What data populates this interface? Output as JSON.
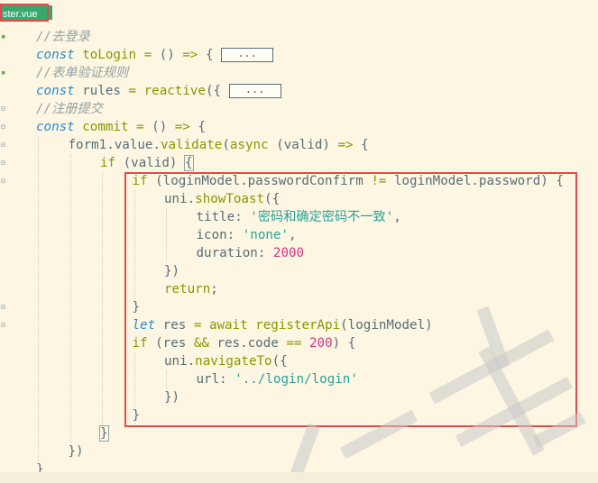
{
  "tab": {
    "label": "ster.vue"
  },
  "gutter_marks": [
    {
      "symbol": "▪",
      "kind": "g"
    },
    {
      "symbol": "",
      "kind": ""
    },
    {
      "symbol": "▪",
      "kind": "g"
    },
    {
      "symbol": "",
      "kind": ""
    },
    {
      "symbol": "⊟",
      "kind": ""
    },
    {
      "symbol": "⊟",
      "kind": ""
    },
    {
      "symbol": "⊟",
      "kind": ""
    },
    {
      "symbol": "⊟",
      "kind": ""
    },
    {
      "symbol": "⊟",
      "kind": ""
    },
    {
      "symbol": "",
      "kind": ""
    },
    {
      "symbol": "",
      "kind": ""
    },
    {
      "symbol": "",
      "kind": ""
    },
    {
      "symbol": "",
      "kind": ""
    },
    {
      "symbol": "",
      "kind": ""
    },
    {
      "symbol": "",
      "kind": ""
    },
    {
      "symbol": "⊟",
      "kind": ""
    },
    {
      "symbol": "⊟",
      "kind": ""
    },
    {
      "symbol": "",
      "kind": ""
    },
    {
      "symbol": "",
      "kind": ""
    },
    {
      "symbol": "",
      "kind": ""
    },
    {
      "symbol": "",
      "kind": ""
    },
    {
      "symbol": "",
      "kind": ""
    },
    {
      "symbol": "",
      "kind": ""
    },
    {
      "symbol": "",
      "kind": ""
    },
    {
      "symbol": "",
      "kind": ""
    }
  ],
  "code_lines": [
    {
      "indent": 0,
      "tokens": [
        [
          "cm",
          "//去登录"
        ]
      ]
    },
    {
      "indent": 0,
      "tokens": [
        [
          "kw",
          "const"
        ],
        [
          "id",
          " "
        ],
        [
          "fn",
          "toLogin"
        ],
        [
          "id",
          " "
        ],
        [
          "op",
          "="
        ],
        [
          "id",
          " () "
        ],
        [
          "op",
          "=>"
        ],
        [
          "id",
          " { "
        ],
        [
          "fold",
          "..."
        ]
      ]
    },
    {
      "indent": 0,
      "tokens": [
        [
          "cm",
          "//表单验证规则"
        ]
      ]
    },
    {
      "indent": 0,
      "tokens": [
        [
          "kw",
          "const"
        ],
        [
          "id",
          " rules "
        ],
        [
          "op",
          "="
        ],
        [
          "id",
          " "
        ],
        [
          "fn",
          "reactive"
        ],
        [
          "id",
          "({ "
        ],
        [
          "fold",
          "..."
        ]
      ]
    },
    {
      "indent": 0,
      "tokens": [
        [
          "cm",
          "//注册提交"
        ]
      ]
    },
    {
      "indent": 0,
      "tokens": [
        [
          "kw",
          "const"
        ],
        [
          "id",
          " "
        ],
        [
          "fn",
          "commit"
        ],
        [
          "id",
          " "
        ],
        [
          "op",
          "="
        ],
        [
          "id",
          " () "
        ],
        [
          "op",
          "=>"
        ],
        [
          "id",
          " {"
        ]
      ]
    },
    {
      "indent": 1,
      "tokens": [
        [
          "id",
          "form1.value."
        ],
        [
          "fn",
          "validate"
        ],
        [
          "id",
          "("
        ],
        [
          "op",
          "async"
        ],
        [
          "id",
          " (valid) "
        ],
        [
          "op",
          "=>"
        ],
        [
          "id",
          " {"
        ]
      ]
    },
    {
      "indent": 2,
      "tokens": [
        [
          "op",
          "if"
        ],
        [
          "id",
          " (valid) "
        ],
        [
          "bm",
          "{"
        ]
      ]
    },
    {
      "indent": 3,
      "tokens": [
        [
          "op",
          "if"
        ],
        [
          "id",
          " (loginModel.passwordConfirm "
        ],
        [
          "op",
          "!="
        ],
        [
          "id",
          " loginModel.password) {"
        ]
      ]
    },
    {
      "indent": 4,
      "tokens": [
        [
          "id",
          "uni."
        ],
        [
          "fn",
          "showToast"
        ],
        [
          "id",
          "({"
        ]
      ]
    },
    {
      "indent": 5,
      "tokens": [
        [
          "id",
          "title: "
        ],
        [
          "str",
          "'密码和确定密码不一致'"
        ],
        [
          "id",
          ","
        ]
      ]
    },
    {
      "indent": 5,
      "tokens": [
        [
          "id",
          "icon: "
        ],
        [
          "str",
          "'none'"
        ],
        [
          "id",
          ","
        ]
      ]
    },
    {
      "indent": 5,
      "tokens": [
        [
          "id",
          "duration: "
        ],
        [
          "num",
          "2000"
        ]
      ]
    },
    {
      "indent": 4,
      "tokens": [
        [
          "id",
          "})"
        ]
      ]
    },
    {
      "indent": 4,
      "tokens": [
        [
          "op",
          "return"
        ],
        [
          "id",
          ";"
        ]
      ]
    },
    {
      "indent": 3,
      "tokens": [
        [
          "id",
          "}"
        ]
      ]
    },
    {
      "indent": 3,
      "tokens": [
        [
          "kw",
          "let"
        ],
        [
          "id",
          " res "
        ],
        [
          "op",
          "="
        ],
        [
          "id",
          " "
        ],
        [
          "op",
          "await"
        ],
        [
          "id",
          " "
        ],
        [
          "fn",
          "registerApi"
        ],
        [
          "id",
          "(loginModel)"
        ]
      ]
    },
    {
      "indent": 3,
      "tokens": [
        [
          "op",
          "if"
        ],
        [
          "id",
          " (res "
        ],
        [
          "op",
          "&&"
        ],
        [
          "id",
          " res.code "
        ],
        [
          "op",
          "=="
        ],
        [
          "id",
          " "
        ],
        [
          "num",
          "200"
        ],
        [
          "id",
          ") {"
        ]
      ]
    },
    {
      "indent": 4,
      "tokens": [
        [
          "id",
          "uni."
        ],
        [
          "fn",
          "navigateTo"
        ],
        [
          "id",
          "({"
        ]
      ]
    },
    {
      "indent": 5,
      "tokens": [
        [
          "id",
          "url: "
        ],
        [
          "str",
          "'../login/login'"
        ]
      ]
    },
    {
      "indent": 4,
      "tokens": [
        [
          "id",
          "})"
        ]
      ]
    },
    {
      "indent": 3,
      "tokens": [
        [
          "id",
          "}"
        ]
      ]
    },
    {
      "indent": 2,
      "tokens": [
        [
          "bm",
          "}"
        ]
      ]
    },
    {
      "indent": 1,
      "tokens": [
        [
          "id",
          "})"
        ]
      ]
    },
    {
      "indent": 0,
      "tokens": [
        [
          "id",
          "}"
        ]
      ]
    }
  ],
  "colors": {
    "background": "#fdf6e3",
    "keyword": "#268bd2",
    "function": "#859900",
    "string": "#2aa198",
    "number": "#d33682",
    "comment": "#93a1a1",
    "highlight_box": "#e04b4b",
    "tab_green": "#3aa76d"
  }
}
